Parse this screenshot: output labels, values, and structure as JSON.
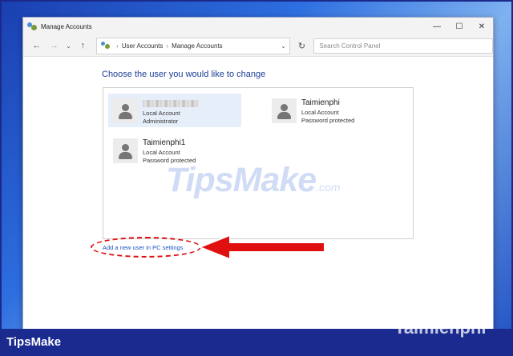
{
  "window": {
    "title": "Manage Accounts",
    "controls": {
      "minimize": "—",
      "maximize": "☐",
      "close": "✕"
    }
  },
  "toolbar": {
    "back": "←",
    "forward": "→",
    "recent": "⌄",
    "up": "↑",
    "breadcrumb": [
      "User Accounts",
      "Manage Accounts"
    ],
    "dropdown": "⌄",
    "refresh": "↻",
    "search_placeholder": "Search Control Panel"
  },
  "main": {
    "heading": "Choose the user you would like to change",
    "users": [
      {
        "name": "",
        "type": "Local Account",
        "detail": "Administrator",
        "selected": true
      },
      {
        "name": "Taimienphi",
        "type": "Local Account",
        "detail": "Password protected",
        "selected": false
      },
      {
        "name": "Taimienphi1",
        "type": "Local Account",
        "detail": "Password protected",
        "selected": false
      }
    ],
    "add_user_link": "Add a new user in PC settings"
  },
  "watermark": {
    "text": "TipsMake",
    "suffix": ".com"
  },
  "footer": {
    "brand": "TipsMake",
    "brand_right": "Taimienphi"
  },
  "colors": {
    "accent": "#1c3e96",
    "link": "#1a55c2",
    "highlight": "#e01010",
    "footer": "#1a2a8f"
  },
  "icons": [
    "user-accounts-icon",
    "back-icon",
    "forward-icon",
    "up-icon",
    "refresh-icon",
    "user-avatar-icon"
  ]
}
